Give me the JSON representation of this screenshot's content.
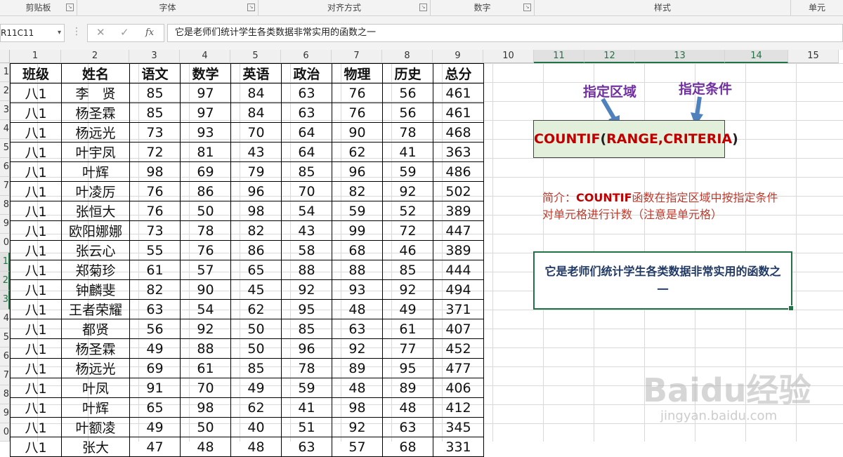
{
  "ribbon": {
    "groups": [
      "剪贴板",
      "字体",
      "对齐方式",
      "数字",
      "样式",
      "单元"
    ]
  },
  "formula_bar": {
    "name_box": "R11C11",
    "dots": "⋮",
    "cancel": "✕",
    "enter": "✓",
    "fx": "fx",
    "content": "它是老师们统计学生各类数据非常实用的函数之一"
  },
  "columns": [
    "1",
    "2",
    "3",
    "4",
    "5",
    "6",
    "7",
    "8",
    "9",
    "10",
    "11",
    "12",
    "13",
    "14",
    "15"
  ],
  "rows": [
    "1",
    "2",
    "3",
    "4",
    "5",
    "6",
    "7",
    "8",
    "9",
    "0",
    "1",
    "2",
    "3",
    "4",
    "5",
    "6",
    "7",
    "8",
    "9",
    "0"
  ],
  "table": {
    "headers": [
      "班级",
      "姓名",
      "语文",
      "数学",
      "英语",
      "政治",
      "物理",
      "历史",
      "总分"
    ],
    "rows": [
      [
        "八1",
        "李　贤",
        "85",
        "97",
        "84",
        "63",
        "76",
        "56",
        "461"
      ],
      [
        "八1",
        "杨圣霖",
        "85",
        "97",
        "84",
        "63",
        "76",
        "56",
        "461"
      ],
      [
        "八1",
        "杨远光",
        "73",
        "93",
        "70",
        "64",
        "90",
        "78",
        "468"
      ],
      [
        "八1",
        "叶宇凤",
        "72",
        "81",
        "43",
        "64",
        "62",
        "41",
        "363"
      ],
      [
        "八1",
        "叶辉",
        "98",
        "69",
        "79",
        "85",
        "96",
        "59",
        "486"
      ],
      [
        "八1",
        "叶凌厉",
        "76",
        "86",
        "96",
        "70",
        "82",
        "92",
        "502"
      ],
      [
        "八1",
        "张恒大",
        "76",
        "50",
        "98",
        "54",
        "59",
        "52",
        "389"
      ],
      [
        "八1",
        "欧阳娜娜",
        "73",
        "78",
        "82",
        "43",
        "99",
        "72",
        "447"
      ],
      [
        "八1",
        "张云心",
        "55",
        "76",
        "86",
        "58",
        "68",
        "46",
        "389"
      ],
      [
        "八1",
        "郑菊珍",
        "61",
        "57",
        "65",
        "88",
        "88",
        "85",
        "444"
      ],
      [
        "八1",
        "钟麟斐",
        "82",
        "90",
        "45",
        "92",
        "93",
        "92",
        "494"
      ],
      [
        "八1",
        "王者荣耀",
        "63",
        "54",
        "62",
        "95",
        "48",
        "49",
        "371"
      ],
      [
        "八1",
        "都贤",
        "56",
        "92",
        "50",
        "85",
        "63",
        "61",
        "407"
      ],
      [
        "八1",
        "杨圣霖",
        "49",
        "88",
        "50",
        "96",
        "92",
        "77",
        "452"
      ],
      [
        "八1",
        "杨远光",
        "69",
        "61",
        "85",
        "78",
        "89",
        "95",
        "477"
      ],
      [
        "八1",
        "叶凤",
        "91",
        "70",
        "49",
        "59",
        "48",
        "89",
        "406"
      ],
      [
        "八1",
        "叶辉",
        "65",
        "98",
        "62",
        "41",
        "98",
        "48",
        "412"
      ],
      [
        "八1",
        "叶额凌",
        "49",
        "50",
        "40",
        "51",
        "92",
        "63",
        "345"
      ],
      [
        "八1",
        "张大",
        "47",
        "48",
        "48",
        "63",
        "57",
        "68",
        "331"
      ]
    ]
  },
  "annotations": {
    "range_label": "指定区域",
    "criteria_label": "指定条件",
    "formula_fn": "COUNTIF",
    "formula_open": "(",
    "formula_args": "RANGE,CRITERIA",
    "formula_close": ")",
    "intro_prefix": "简介：",
    "intro_fn": "COUNTIF",
    "intro_text": "函数在指定区域中按指定条件对单元格进行计数（注意是单元格）",
    "note": "它是老师们统计学生各类数据非常实用的函数之一"
  },
  "watermark": {
    "logo": "Baidu经验",
    "url": "jingyan.baidu.com"
  },
  "colors": {
    "excel_green": "#217346",
    "purple": "#7030a0",
    "red": "#c00000",
    "formula_fill": "#e2efda",
    "note_text": "#1f3864"
  }
}
